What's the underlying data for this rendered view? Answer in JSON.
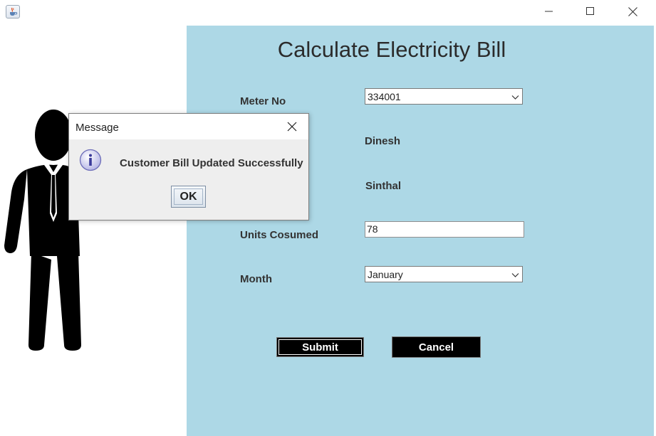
{
  "window": {
    "icon": "java-cup-icon",
    "controls": [
      "minimize-icon",
      "maximize-icon",
      "close-icon"
    ]
  },
  "form": {
    "title": "Calculate Electricity Bill",
    "meter_label": "Meter No",
    "meter_value": "334001",
    "name_value": "Dinesh",
    "address_value": "Sinthal",
    "units_label": "Units Cosumed",
    "units_value": "78",
    "month_label": "Month",
    "month_value": "January",
    "submit_label": "Submit",
    "cancel_label": "Cancel"
  },
  "dialog": {
    "title": "Message",
    "message": "Customer Bill Updated Successfully",
    "ok_label": "OK",
    "icon": "info-icon"
  },
  "colors": {
    "panel_bg": "#add8e6",
    "button_bg": "#000000",
    "dialog_bg": "#eeeeee"
  }
}
